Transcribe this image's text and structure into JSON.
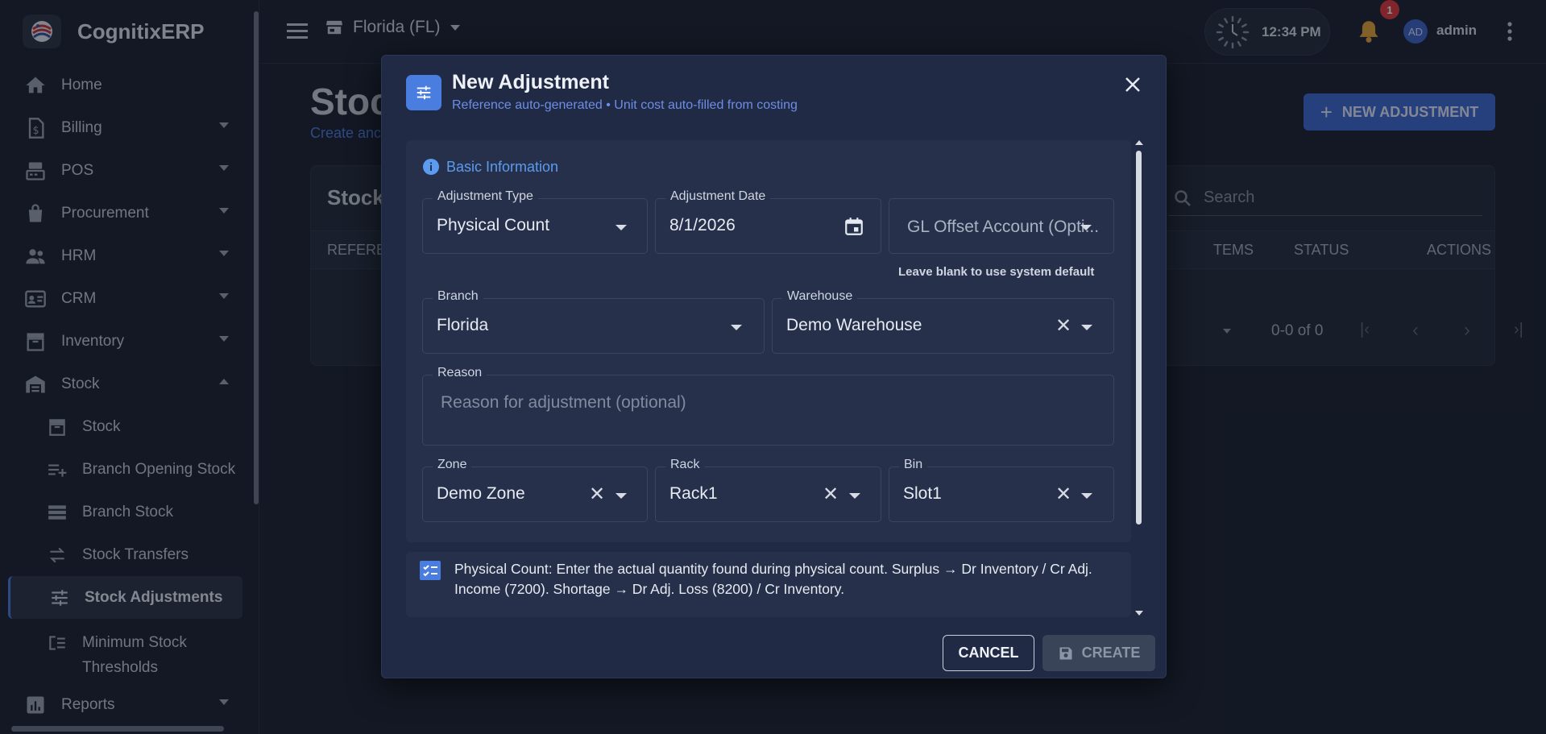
{
  "app": {
    "name": "CognitixERP"
  },
  "sidebar": {
    "items": [
      {
        "label": "Home",
        "icon": "home-icon"
      },
      {
        "label": "Billing",
        "icon": "billing-icon"
      },
      {
        "label": "POS",
        "icon": "pos-icon"
      },
      {
        "label": "Procurement",
        "icon": "bag-icon"
      },
      {
        "label": "HRM",
        "icon": "people-icon"
      },
      {
        "label": "CRM",
        "icon": "contact-card-icon"
      },
      {
        "label": "Inventory",
        "icon": "archive-icon"
      },
      {
        "label": "Stock",
        "icon": "warehouse-icon"
      }
    ],
    "stock_sub": [
      {
        "label": "Stock",
        "icon": "archive-icon"
      },
      {
        "label": "Branch Opening Stock",
        "icon": "playlist-add-icon"
      },
      {
        "label": "Branch Stock",
        "icon": "storage-icon"
      },
      {
        "label": "Stock Transfers",
        "icon": "swap-icon"
      },
      {
        "label": "Stock Adjustments",
        "icon": "tune-icon"
      },
      {
        "label": "Minimum Stock Thresholds",
        "icon": "threshold-icon"
      }
    ],
    "reports": {
      "label": "Reports",
      "icon": "chart-icon"
    }
  },
  "topbar": {
    "branch": "Florida (FL)",
    "time": "12:34 PM",
    "notifications": "1",
    "avatar": "AD",
    "user": "admin"
  },
  "page": {
    "title": "Stoc",
    "subtitle": "Create anc",
    "new_button": "NEW ADJUSTMENT",
    "card_title": "Stock",
    "search_placeholder": "Search",
    "columns": {
      "reference": "REFERE",
      "items": "TEMS",
      "status": "STATUS",
      "actions": "ACTIONS"
    },
    "pagination": "0-0 of 0"
  },
  "dialog": {
    "title": "New Adjustment",
    "subtitle": "Reference auto-generated • Unit cost auto-filled from costing",
    "section": "Basic Information",
    "adjustment_type": {
      "label": "Adjustment Type",
      "value": "Physical Count"
    },
    "adjustment_date": {
      "label": "Adjustment Date",
      "value": "8/1/2026"
    },
    "gl_offset": {
      "placeholder": "GL Offset Account (Opti...",
      "helper": "Leave blank to use system default"
    },
    "branch": {
      "label": "Branch",
      "value": "Florida"
    },
    "warehouse": {
      "label": "Warehouse",
      "value": "Demo Warehouse"
    },
    "reason": {
      "label": "Reason",
      "placeholder": "Reason for adjustment (optional)"
    },
    "zone": {
      "label": "Zone",
      "value": "Demo Zone"
    },
    "rack": {
      "label": "Rack",
      "value": "Rack1"
    },
    "bin": {
      "label": "Bin",
      "value": "Slot1"
    },
    "info": "Physical Count: Enter the actual quantity found during physical count. Surplus → Dr Inventory / Cr Adj. Income (7200). Shortage → Dr Adj. Loss (8200) / Cr Inventory.",
    "cancel": "CANCEL",
    "create": "CREATE"
  },
  "colors": {
    "accent": "#4a7de0",
    "background": "#1b2232",
    "dialog": "#202a44",
    "danger": "#e0393f"
  }
}
